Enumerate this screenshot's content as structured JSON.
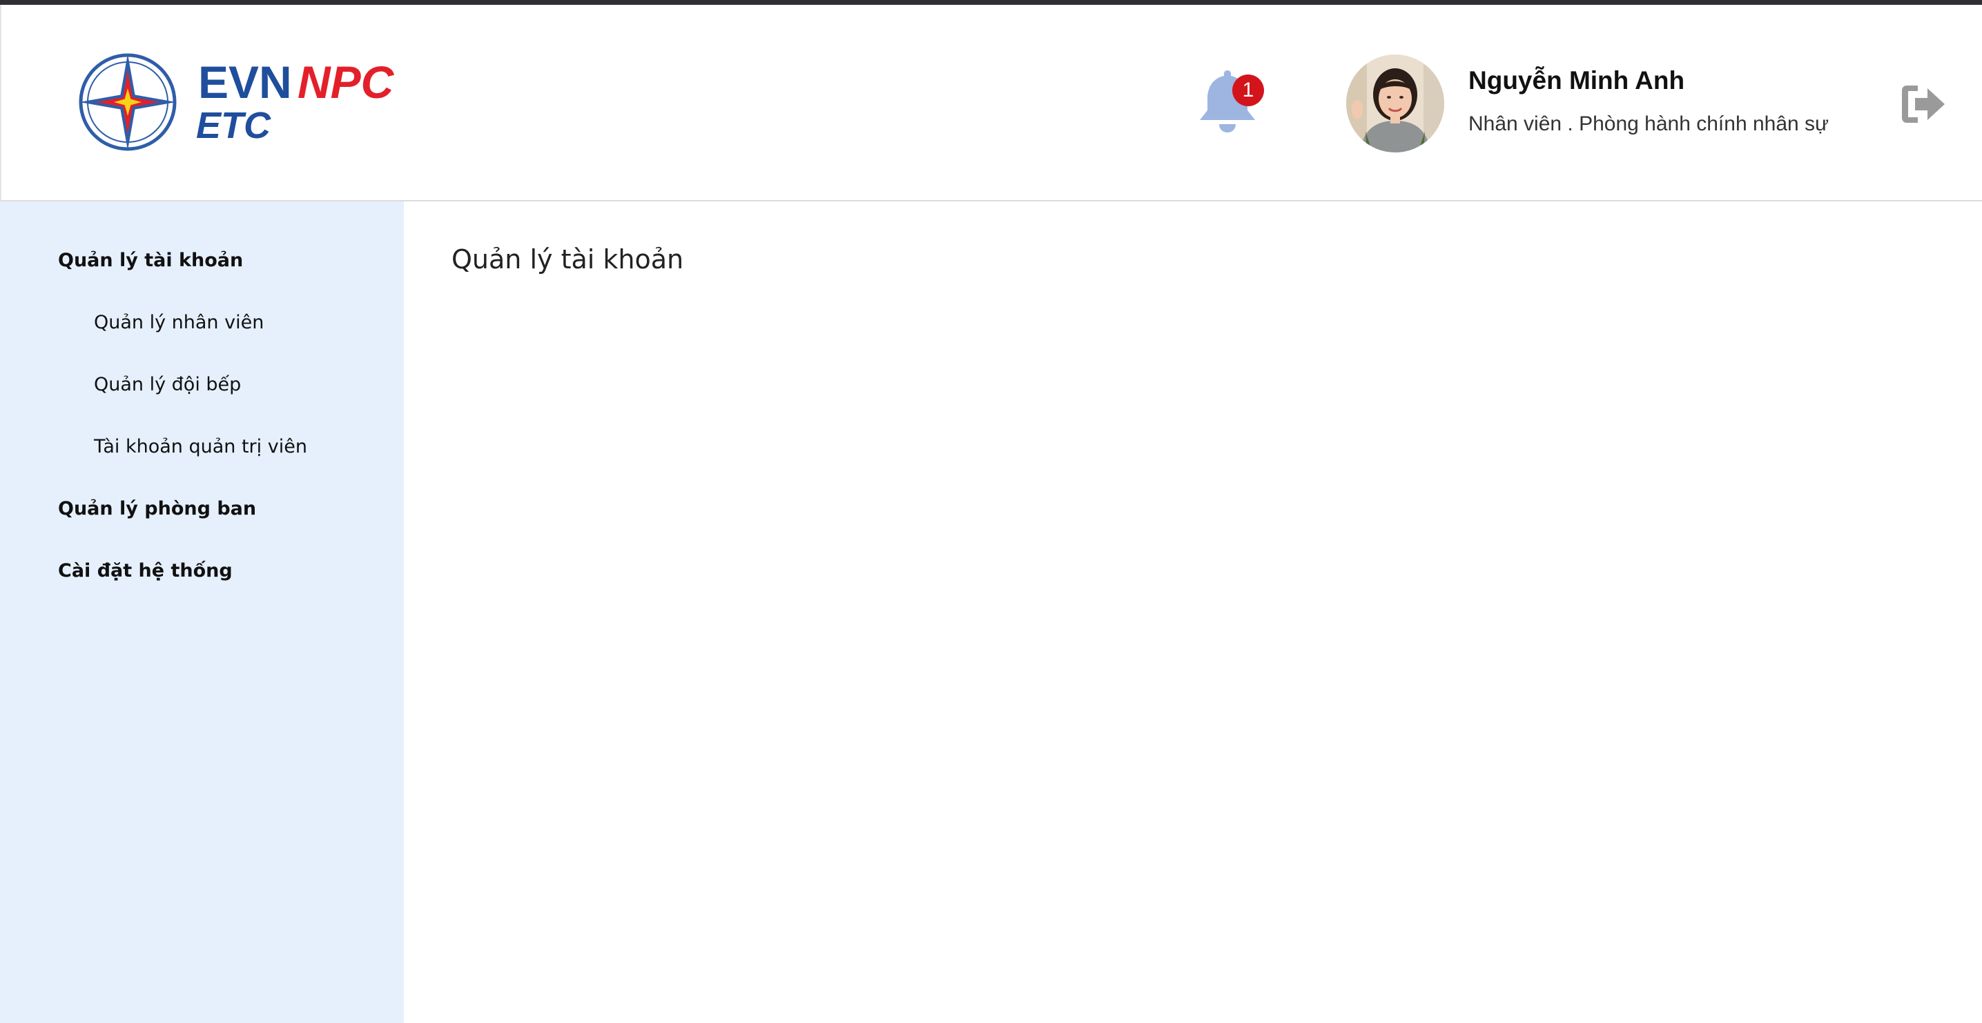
{
  "header": {
    "logo": {
      "brand_primary": "EVN",
      "brand_accent": "NPC",
      "brand_secondary": "ETC",
      "primary_color": "#1f4e9c",
      "accent_color": "#e3202a"
    },
    "notifications": {
      "icon": "bell-icon",
      "badge_count": "1",
      "badge_color": "#d3141b"
    },
    "user": {
      "name": "Nguyễn Minh Anh",
      "role": "Nhân viên . Phòng hành chính nhân sự",
      "avatar_icon": "user-avatar"
    },
    "logout": {
      "icon": "logout-icon"
    }
  },
  "sidebar": {
    "background_color": "#e6f0fd",
    "items": [
      {
        "label": "Quản lý tài khoản",
        "level": 1
      },
      {
        "label": "Quản lý nhân viên",
        "level": 2
      },
      {
        "label": "Quản lý đội bếp",
        "level": 2
      },
      {
        "label": "Tài khoản quản trị viên",
        "level": 2
      },
      {
        "label": "Quản lý phòng ban",
        "level": 1
      },
      {
        "label": "Cài đặt hệ thống",
        "level": 1
      }
    ]
  },
  "main": {
    "title": "Quản lý tài khoản"
  }
}
